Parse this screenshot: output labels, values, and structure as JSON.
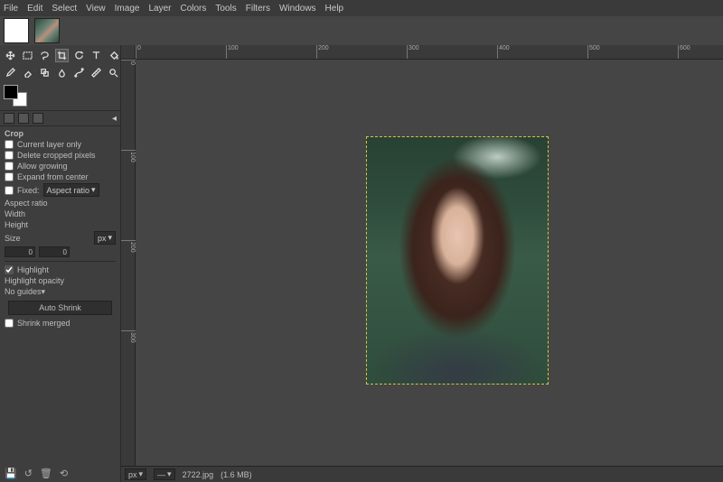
{
  "menubar": [
    "File",
    "Edit",
    "Select",
    "View",
    "Image",
    "Layer",
    "Colors",
    "Tools",
    "Filters",
    "Windows",
    "Help"
  ],
  "tool_options": {
    "title": "Crop",
    "current_layer_only_label": "Current layer only",
    "delete_cropped_label": "Delete cropped pixels",
    "allow_growing_label": "Allow growing",
    "expand_from_center_label": "Expand from center",
    "fixed_label": "Fixed:",
    "fixed_mode": "Aspect ratio",
    "aspect_ratio_label": "Aspect ratio",
    "width_label": "Width",
    "height_label": "Height",
    "size_label": "Size",
    "unit": "px",
    "x_value": "0",
    "y_value": "0",
    "highlight_label": "Highlight",
    "highlight_opacity_label": "Highlight opacity",
    "guides_value": "No guides",
    "auto_shrink_label": "Auto Shrink",
    "shrink_merged_label": "Shrink merged"
  },
  "ruler_h": [
    "0",
    "100",
    "200",
    "300",
    "400",
    "500",
    "600"
  ],
  "ruler_v": [
    "0",
    "100",
    "200",
    "300"
  ],
  "status": {
    "zoom": "—",
    "filename": "2722.jpg",
    "filesize": "(1.6 MB)"
  }
}
